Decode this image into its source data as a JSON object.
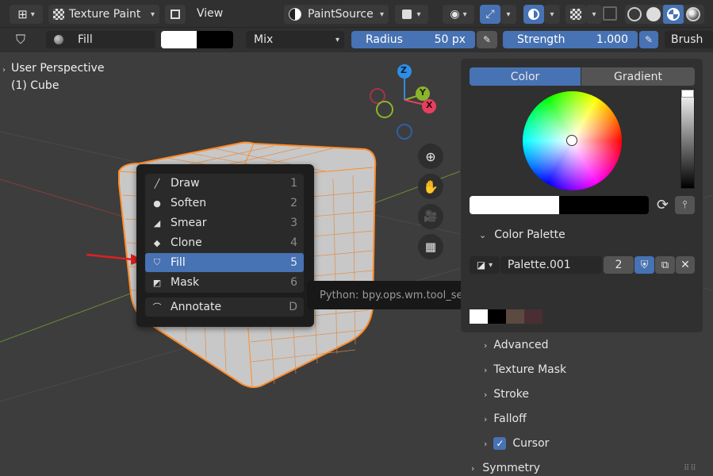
{
  "header": {
    "editor_type_icon": "editor-type-icon",
    "mode": "Texture Paint",
    "view_menu": "View",
    "paint_source": "PaintSource"
  },
  "tool_settings": {
    "brush_name": "Fill",
    "blend_mode": "Mix",
    "radius_label": "Radius",
    "radius_value": "50 px",
    "strength_label": "Strength",
    "strength_value": "1.000",
    "brush_menu": "Brush"
  },
  "viewport": {
    "perspective": "User Perspective",
    "object": "(1) Cube",
    "gizmo": {
      "z": "Z",
      "y": "Y",
      "x": "X"
    }
  },
  "tool_menu": {
    "items": [
      {
        "label": "Draw",
        "key": "1",
        "icon": "draw-brush-icon"
      },
      {
        "label": "Soften",
        "key": "2",
        "icon": "soften-brush-icon"
      },
      {
        "label": "Smear",
        "key": "3",
        "icon": "smear-brush-icon"
      },
      {
        "label": "Clone",
        "key": "4",
        "icon": "clone-brush-icon"
      },
      {
        "label": "Fill",
        "key": "5",
        "icon": "fill-brush-icon"
      },
      {
        "label": "Mask",
        "key": "6",
        "icon": "mask-brush-icon"
      }
    ],
    "annotate": {
      "label": "Annotate",
      "key": "D"
    },
    "selected_index": 4
  },
  "tooltip": {
    "text": "Python: bpy.ops.wm.tool_set_by_id(name=\"builtin_brush.Mask\")"
  },
  "color_panel": {
    "tabs": [
      "Color",
      "Gradient"
    ],
    "active_tab": "Color",
    "primary_color": "#ffffff",
    "secondary_color": "#000000",
    "palette_section": "Color Palette",
    "palette_name": "Palette.001",
    "palette_users": "2",
    "palette_swatches": [
      "#ffffff",
      "#000000",
      "#5a4a40",
      "#4a2e33"
    ]
  },
  "sections": {
    "items": [
      "Advanced",
      "Texture Mask",
      "Stroke",
      "Falloff",
      "Cursor"
    ],
    "cursor_checked": true,
    "symmetry": "Symmetry"
  },
  "colors": {
    "accent": "#4772b3",
    "mesh_edge": "#ff8c2a",
    "gizmo_x": "#e5405f",
    "gizmo_y": "#8bb42c",
    "gizmo_z": "#2e8ee5"
  }
}
